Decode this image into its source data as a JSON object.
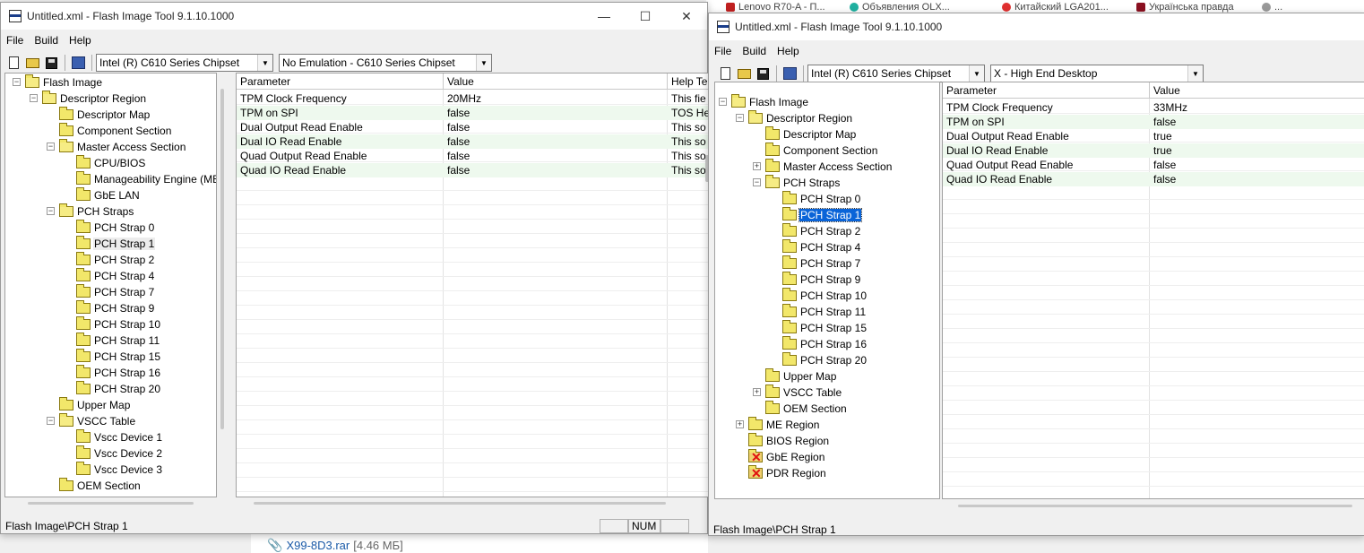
{
  "background": {
    "tabs": [
      "Lenovo R70-A - П...",
      "Объявления OLX...",
      "Китайский LGA201...",
      "Українська правда",
      "..."
    ],
    "attachment_name": "X99-8D3.rar",
    "attachment_size": "[4.46 МБ]"
  },
  "left_window": {
    "title": "Untitled.xml - Flash Image Tool 9.1.10.1000",
    "controls": {
      "minimize": "—",
      "maximize": "☐",
      "close": "✕"
    },
    "menu": [
      "File",
      "Build",
      "Help"
    ],
    "combo1": "Intel (R) C610 Series Chipset",
    "combo2": "No Emulation - C610 Series Chipset",
    "tree": [
      "Flash Image",
      "Descriptor Region",
      "Descriptor Map",
      "Component Section",
      "Master Access Section",
      "CPU/BIOS",
      "Manageability Engine (ME",
      "GbE LAN",
      "PCH Straps",
      "PCH Strap 0",
      "PCH Strap 1",
      "PCH Strap 2",
      "PCH Strap 4",
      "PCH Strap 7",
      "PCH Strap 9",
      "PCH Strap 10",
      "PCH Strap 11",
      "PCH Strap 15",
      "PCH Strap 16",
      "PCH Strap 20",
      "Upper Map",
      "VSCC Table",
      "Vscc Device 1",
      "Vscc Device 2",
      "Vscc Device 3",
      "OEM Section"
    ],
    "columns": [
      "Parameter",
      "Value",
      "Help Te"
    ],
    "rows": [
      [
        "TPM Clock Frequency",
        "20MHz",
        "This fie"
      ],
      [
        "TPM on SPI",
        "false",
        "TOS He"
      ],
      [
        "Dual Output Read Enable",
        "false",
        "This so"
      ],
      [
        "Dual IO Read Enable",
        "false",
        "This so"
      ],
      [
        "Quad Output Read Enable",
        "false",
        "This so"
      ],
      [
        "Quad IO Read Enable",
        "false",
        "This so"
      ]
    ],
    "status": "Flash Image\\PCH Strap 1",
    "status_num": "NUM"
  },
  "right_window": {
    "title": "Untitled.xml - Flash Image Tool 9.1.10.1000",
    "menu": [
      "File",
      "Build",
      "Help"
    ],
    "combo1": "Intel (R) C610 Series Chipset",
    "combo2": "X - High End Desktop",
    "tree": [
      "Flash Image",
      "Descriptor Region",
      "Descriptor Map",
      "Component Section",
      "Master Access Section",
      "PCH Straps",
      "PCH Strap 0",
      "PCH Strap 1",
      "PCH Strap 2",
      "PCH Strap 4",
      "PCH Strap 7",
      "PCH Strap 9",
      "PCH Strap 10",
      "PCH Strap 11",
      "PCH Strap 15",
      "PCH Strap 16",
      "PCH Strap 20",
      "Upper Map",
      "VSCC Table",
      "OEM Section",
      "ME Region",
      "BIOS Region",
      "GbE Region",
      "PDR Region"
    ],
    "columns": [
      "Parameter",
      "Value"
    ],
    "rows": [
      [
        "TPM Clock Frequency",
        "33MHz"
      ],
      [
        "TPM on SPI",
        "false"
      ],
      [
        "Dual Output Read Enable",
        "true"
      ],
      [
        "Dual IO Read Enable",
        "true"
      ],
      [
        "Quad Output Read Enable",
        "false"
      ],
      [
        "Quad IO Read Enable",
        "false"
      ]
    ],
    "status": "Flash Image\\PCH Strap 1"
  }
}
